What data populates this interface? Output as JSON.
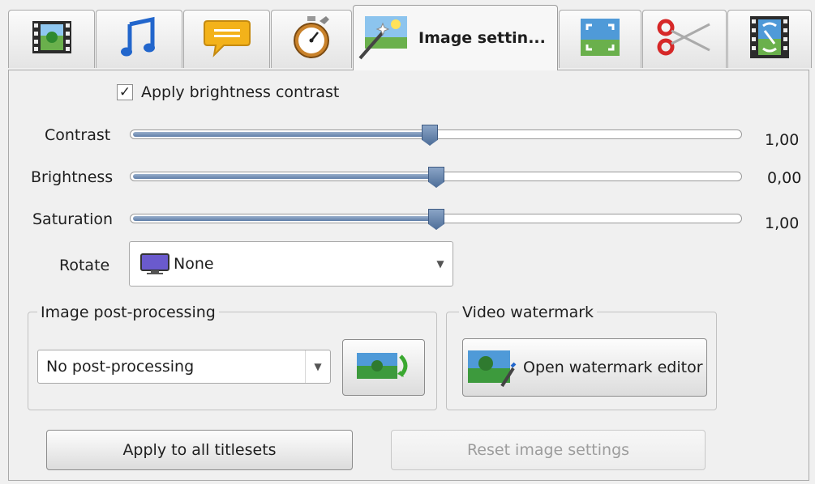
{
  "tabs": [
    {
      "icon": "film-image-icon"
    },
    {
      "icon": "music-note-icon"
    },
    {
      "icon": "speech-bubble-icon"
    },
    {
      "icon": "stopwatch-icon"
    },
    {
      "icon": "image-settings-icon",
      "label": "Image settin..."
    },
    {
      "icon": "crop-frame-icon"
    },
    {
      "icon": "scissors-icon"
    },
    {
      "icon": "film-link-icon"
    }
  ],
  "brightness_contrast": {
    "label": "Apply brightness contrast",
    "checked": true
  },
  "sliders": [
    {
      "label": "Contrast",
      "value": "1,00",
      "position": 0.49
    },
    {
      "label": "Brightness",
      "value": "0,00",
      "position": 0.5
    },
    {
      "label": "Saturation",
      "value": "1,00",
      "position": 0.5
    }
  ],
  "rotate": {
    "label": "Rotate",
    "value": "None"
  },
  "post_processing": {
    "title": "Image post-processing",
    "value": "No post-processing"
  },
  "watermark": {
    "title": "Video watermark",
    "button_label": "Open watermark editor"
  },
  "buttons": {
    "apply_all": "Apply to all titlesets",
    "reset": "Reset image settings"
  },
  "colors": {
    "slider_fill": "#5f7ea8",
    "panel_bg": "#f0f0f0"
  }
}
